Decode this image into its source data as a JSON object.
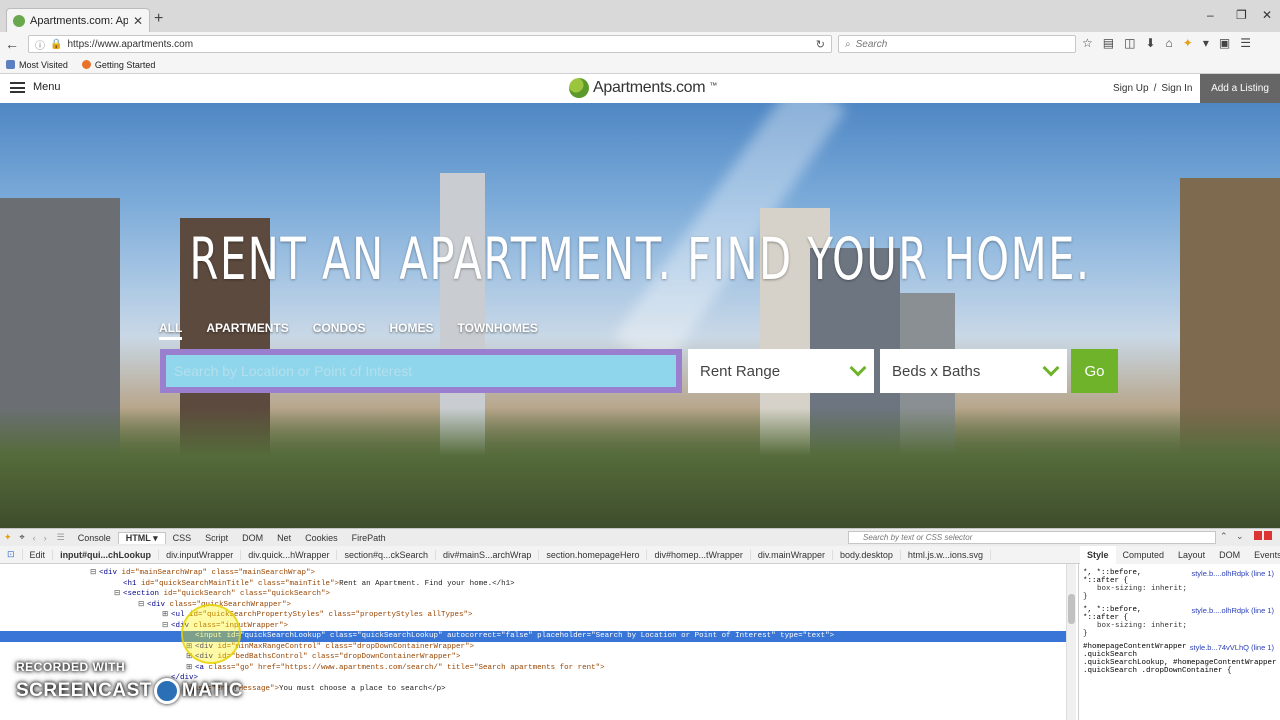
{
  "browser": {
    "tab_title": "Apartments.com: Apartm…",
    "url": "https://www.apartments.com",
    "search_placeholder": "Search",
    "bookmarks": [
      "Most Visited",
      "Getting Started"
    ]
  },
  "site": {
    "menu_label": "Menu",
    "logo_text": "Apartments.com",
    "sign_up": "Sign Up",
    "separator": "/",
    "sign_in": "Sign In",
    "add_listing": "Add a Listing"
  },
  "hero": {
    "headline": "RENT AN APARTMENT. FIND YOUR HOME.",
    "property_tabs": [
      "ALL",
      "APARTMENTS",
      "CONDOS",
      "HOMES",
      "TOWNHOMES"
    ],
    "search_placeholder": "Search by Location or Point of Interest",
    "rent_range": "Rent Range",
    "beds_baths": "Beds x Baths",
    "go_label": "Go"
  },
  "devtools": {
    "tabs": [
      "Console",
      "HTML ▾",
      "CSS",
      "Script",
      "DOM",
      "Net",
      "Cookies",
      "FirePath"
    ],
    "search_placeholder": "Search by text or CSS selector",
    "edit_label": "Edit",
    "breadcrumbs": [
      "input#qui...chLookup",
      "div.inputWrapper",
      "div.quick...hWrapper",
      "section#q...ckSearch",
      "div#mainS...archWrap",
      "section.homepageHero",
      "div#homep...tWrapper",
      "div.mainWrapper",
      "body.desktop",
      "html.js.w...ions.svg"
    ],
    "side_tabs": [
      "Style ▾",
      "Computed",
      "Layout",
      "DOM",
      "Events"
    ],
    "dom_lines": [
      {
        "indent": 6,
        "tw": "⊟",
        "tag": "<div",
        "attrs": " id=\"mainSearchWrap\" class=\"mainSearchWrap\">",
        "text": ""
      },
      {
        "indent": 8,
        "tw": "",
        "tag": "<h1",
        "attrs": " id=\"quickSearchMainTitle\" class=\"mainTitle\">",
        "text": "Rent an Apartment. Find your home.</h1>"
      },
      {
        "indent": 8,
        "tw": "⊟",
        "tag": "<section",
        "attrs": " id=\"quickSearch\" class=\"quickSearch\">",
        "text": ""
      },
      {
        "indent": 10,
        "tw": "⊟",
        "tag": "<div",
        "attrs": " class=\"quickSearchWrapper\">",
        "text": ""
      },
      {
        "indent": 12,
        "tw": "⊞",
        "tag": "<ul",
        "attrs": " id=\"quickSearchPropertyStyles\" class=\"propertyStyles allTypes\">",
        "text": ""
      },
      {
        "indent": 12,
        "tw": "⊟",
        "tag": "<div",
        "attrs": " class=\"inputWrapper\">",
        "text": ""
      },
      {
        "indent": 14,
        "tw": "",
        "tag": "<input",
        "attrs": " id=\"quickSearchLookup\" class=\"quickSearchLookup\" autocorrect=\"false\" placeholder=\"Search by Location or Point of Interest\" type=\"text\">",
        "text": "",
        "highlight": true
      },
      {
        "indent": 14,
        "tw": "⊞",
        "tag": "<div",
        "attrs": " id=\"minMaxRangeControl\" class=\"dropDownContainerWrapper\">",
        "text": ""
      },
      {
        "indent": 14,
        "tw": "⊞",
        "tag": "<div",
        "attrs": " id=\"bedBathsControl\" class=\"dropDownContainerWrapper\">",
        "text": ""
      },
      {
        "indent": 14,
        "tw": "⊞",
        "tag": "<a",
        "attrs": " class=\"go\" href=\"https://www.apartments.com/search/\" title=\"Search apartments for rent\">",
        "text": ""
      },
      {
        "indent": 12,
        "tw": "",
        "tag": "</div>",
        "attrs": "",
        "text": ""
      },
      {
        "indent": 12,
        "tw": "",
        "tag": "<p",
        "attrs": " class=\"errorMessage\">",
        "text": "You must choose a place to search</p>"
      }
    ],
    "style_rules": [
      {
        "selector": "*, *::before,",
        "selector2": "*::after {",
        "source": "style.b....olhRdpk (line 1)",
        "decl": "box-sizing: inherit;"
      },
      {
        "selector": "*, *::before,",
        "selector2": "*::after {",
        "source": "style.b....olhRdpk (line 1)",
        "decl": "box-sizing: inherit;"
      },
      {
        "selector": "#homepageContentWrapper",
        "selector2": ".quickSearch .quickSearchLookup, #homepageContentWrapper .quickSearch .dropDownContainer {",
        "source": "style.b...74vVLhQ (line 1)",
        "decl": ""
      }
    ]
  },
  "watermark": {
    "line1": "RECORDED WITH",
    "line2a": "SCREENCAST",
    "line2b": "MATIC"
  }
}
